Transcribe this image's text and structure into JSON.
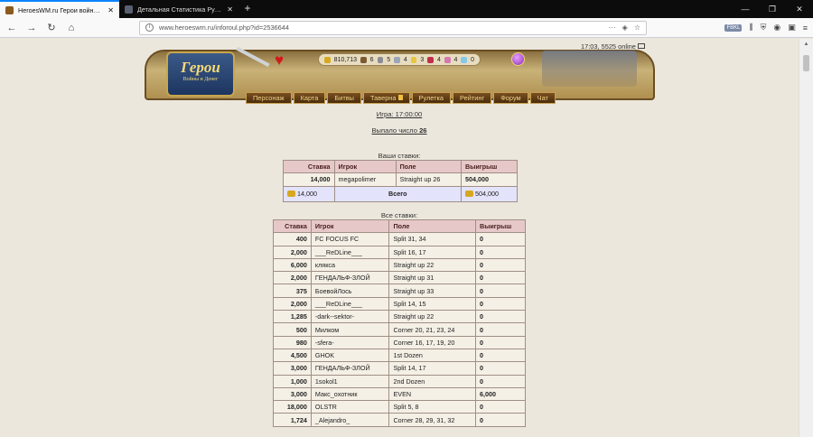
{
  "browser": {
    "tabs": [
      {
        "title": "HeroesWM.ru Герои войны и Денег"
      },
      {
        "title": "Детальная Статистика Рулетки"
      }
    ],
    "url": "www.heroeswm.ru/inforoul.php?id=2536644",
    "url_menu": "···",
    "toolbar_chip": "FBKL"
  },
  "header": {
    "logo_title": "Герои",
    "logo_sub": "Войны и Денег",
    "online_text": "17:03, 5525 online",
    "resources": [
      {
        "icon": "gold-icon",
        "value": "810,713"
      },
      {
        "icon": "wood-icon",
        "value": "6"
      },
      {
        "icon": "ore-icon",
        "value": "5"
      },
      {
        "icon": "mercury-icon",
        "value": "4"
      },
      {
        "icon": "sulfur-icon",
        "value": "3"
      },
      {
        "icon": "crystal-icon",
        "value": "4"
      },
      {
        "icon": "gem-icon",
        "value": "4"
      },
      {
        "icon": "diamond-icon",
        "value": "0"
      }
    ],
    "menu": [
      "Персонаж",
      "Карта",
      "Битвы",
      "Таверна",
      "Рулетка",
      "Рейтинг",
      "Форум",
      "Чат"
    ]
  },
  "game": {
    "time_label": "Игра: 17:00:00",
    "result_label": "Выпало число",
    "result_number": "26"
  },
  "my_bets": {
    "caption": "Ваши ставки:",
    "headers": [
      "Ставка",
      "Игрок",
      "Поле",
      "Выигрыш"
    ],
    "rows": [
      {
        "bet": "14,000",
        "player": "megapolimer",
        "field": "Straight up 26",
        "win": "504,000"
      }
    ],
    "total": {
      "bet": "14,000",
      "label": "Всего",
      "win": "504,000"
    }
  },
  "all_bets": {
    "caption": "Все ставки:",
    "headers": [
      "Ставка",
      "Игрок",
      "Поле",
      "Выигрыш"
    ],
    "rows": [
      {
        "bet": "400",
        "player": "FC FOCUS FC",
        "field": "Split 31, 34",
        "win": "0"
      },
      {
        "bet": "2,000",
        "player": "___ReDLine___",
        "field": "Split 16, 17",
        "win": "0"
      },
      {
        "bet": "6,000",
        "player": "клякса",
        "field": "Straight up 22",
        "win": "0"
      },
      {
        "bet": "2,000",
        "player": "ГЕНДАЛЬФ-ЗЛОЙ",
        "field": "Straight up 31",
        "win": "0"
      },
      {
        "bet": "375",
        "player": "БоевойЛось",
        "field": "Straight up 33",
        "win": "0"
      },
      {
        "bet": "2,000",
        "player": "___ReDLine___",
        "field": "Split 14, 15",
        "win": "0"
      },
      {
        "bet": "1,285",
        "player": "-dark--sektor-",
        "field": "Straight up 22",
        "win": "0"
      },
      {
        "bet": "500",
        "player": "Милком",
        "field": "Corner 20, 21, 23, 24",
        "win": "0"
      },
      {
        "bet": "980",
        "player": "-sfera-",
        "field": "Corner 16, 17, 19, 20",
        "win": "0"
      },
      {
        "bet": "4,500",
        "player": "GHOK",
        "field": "1st Dozen",
        "win": "0"
      },
      {
        "bet": "3,000",
        "player": "ГЕНДАЛЬФ-ЗЛОЙ",
        "field": "Split 14, 17",
        "win": "0"
      },
      {
        "bet": "1,000",
        "player": "1sokol1",
        "field": "2nd Dozen",
        "win": "0"
      },
      {
        "bet": "3,000",
        "player": "Макс_охотник",
        "field": "EVEN",
        "win": "6,000"
      },
      {
        "bet": "18,000",
        "player": "OLSTR",
        "field": "Split 5, 8",
        "win": "0"
      },
      {
        "bet": "1,724",
        "player": "_Alejandro_",
        "field": "Corner 28, 29, 31, 32",
        "win": "0"
      }
    ]
  }
}
